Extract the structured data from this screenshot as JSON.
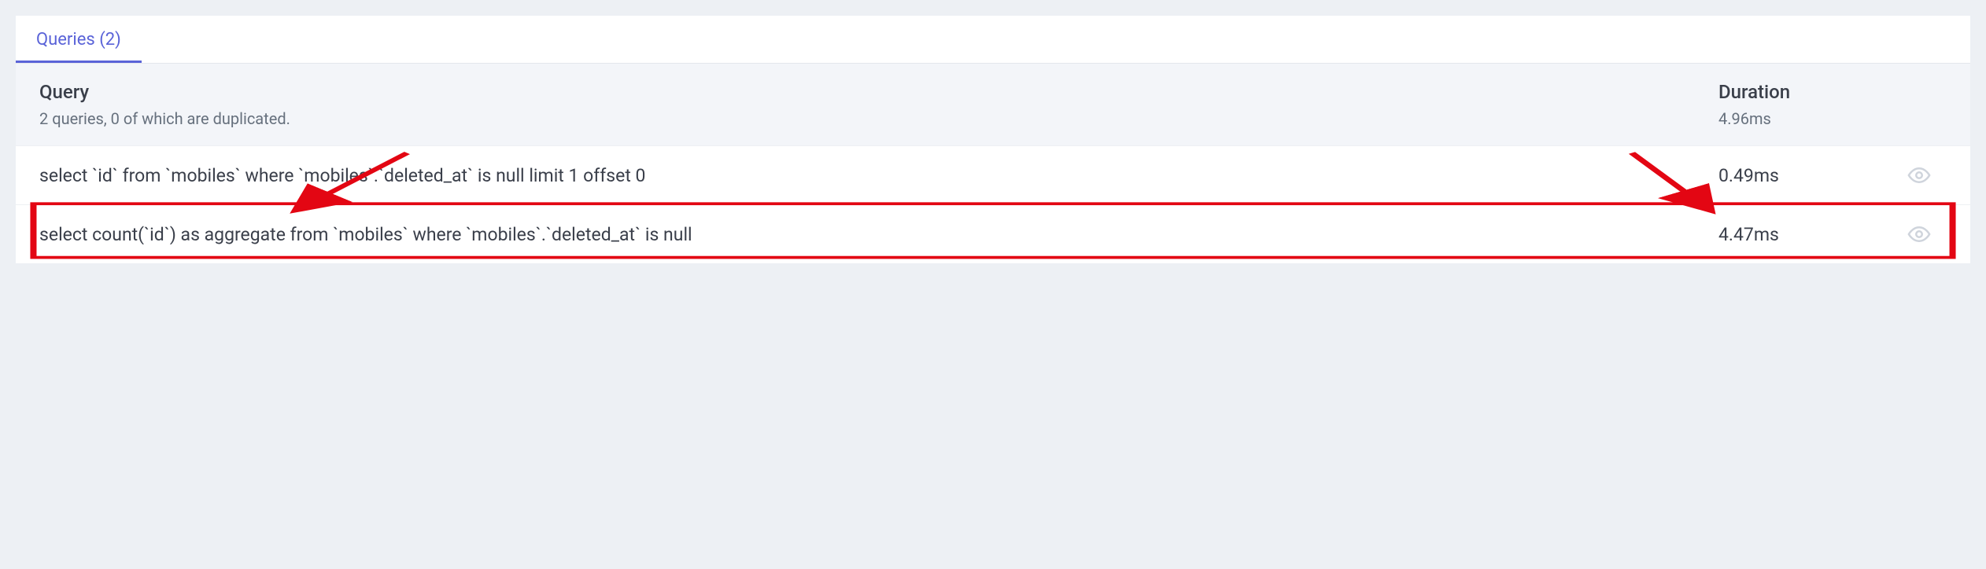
{
  "tabs": {
    "queries_label": "Queries (2)"
  },
  "header": {
    "query_col_title": "Query",
    "query_col_sub": "2 queries, 0 of which are duplicated.",
    "duration_col_title": "Duration",
    "duration_total": "4.96ms"
  },
  "rows": [
    {
      "sql": "select `id` from `mobiles` where `mobiles`.`deleted_at` is null limit 1 offset 0",
      "duration": "0.49ms"
    },
    {
      "sql": "select count(`id`) as aggregate from `mobiles` where `mobiles`.`deleted_at` is null",
      "duration": "4.47ms"
    }
  ]
}
